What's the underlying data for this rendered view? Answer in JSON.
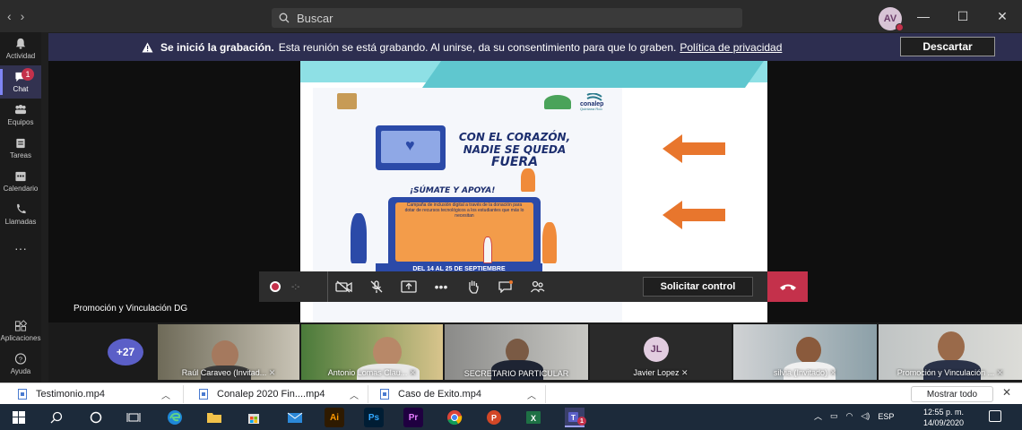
{
  "titlebar": {
    "search_placeholder": "Buscar",
    "avatar_initials": "AV",
    "nav_back": "‹",
    "nav_forward": "›",
    "minimize": "—",
    "maximize": "☐",
    "close": "✕"
  },
  "rail": {
    "items": [
      {
        "label": "Actividad",
        "icon": "bell-icon"
      },
      {
        "label": "Chat",
        "icon": "chat-icon",
        "badge": "1"
      },
      {
        "label": "Equipos",
        "icon": "teams-icon"
      },
      {
        "label": "Tareas",
        "icon": "tasks-icon"
      },
      {
        "label": "Calendario",
        "icon": "calendar-icon"
      },
      {
        "label": "Llamadas",
        "icon": "phone-icon"
      },
      {
        "label": "···",
        "icon": "more-icon"
      }
    ],
    "bottom_items": [
      {
        "label": "Aplicaciones",
        "icon": "apps-icon"
      },
      {
        "label": "Ayuda",
        "icon": "help-icon"
      }
    ]
  },
  "banner": {
    "title": "Se inició la grabación.",
    "message": "Esta reunión se está grabando. Al unirse, da su consentimiento para que lo graben.",
    "link": "Política de privacidad",
    "dismiss": "Descartar"
  },
  "slide": {
    "headline_line1": "CON EL CORAZÓN,",
    "headline_line2": "NADIE SE QUEDA",
    "headline_line3": "FUERA",
    "cta": "¡SÚMATE Y APOYA!",
    "body": "Campaña de inclusión digital a través de la donación para dotar de recursos tecnológicos a los estudiantes que más lo necesitan",
    "logo_text": "conalep",
    "logo_sub": "Quintana Roo",
    "dates": "DEL 14 AL 25 DE SEPTIEMBRE"
  },
  "stage": {
    "presenter_label": "Promoción y Vinculación DG"
  },
  "controls": {
    "timer": "-:-",
    "request_control": "Solicitar control"
  },
  "participants": {
    "more_count": "+27",
    "tiles": [
      {
        "name": "Raúl Caraveo (Invitad..."
      },
      {
        "name": "Antonio Lomas Clau..."
      },
      {
        "name": "SECRETARIO PARTICULAR"
      },
      {
        "name": "Javier Lopez",
        "initials": "JL"
      },
      {
        "name": "silvia (Invitado)"
      },
      {
        "name": "Promoción y Vinculación ..."
      }
    ]
  },
  "downloads": {
    "files": [
      "Testimonio.mp4",
      "Conalep 2020 Fin....mp4",
      "Caso de Exito.mp4"
    ],
    "show_all": "Mostrar todo"
  },
  "taskbar": {
    "apps": [
      "windows-start-icon",
      "search-icon",
      "cortana-icon",
      "task-view-icon",
      "edge-icon",
      "file-explorer-icon",
      "store-icon",
      "mail-icon",
      "illustrator-icon",
      "photoshop-icon",
      "premiere-icon",
      "chrome-icon",
      "powerpoint-icon",
      "excel-icon",
      "teams-icon"
    ],
    "ai_label": "Ai",
    "ps_label": "Ps",
    "pr_label": "Pr",
    "teams_badge": "1",
    "language": "ESP",
    "time": "12:55 p. m.",
    "date": "14/09/2020"
  },
  "colors": {
    "accent": "#5b5fc7",
    "banner_bg": "#2d2e50",
    "hangup": "#c4314b",
    "slide_orange": "#e8762d"
  }
}
